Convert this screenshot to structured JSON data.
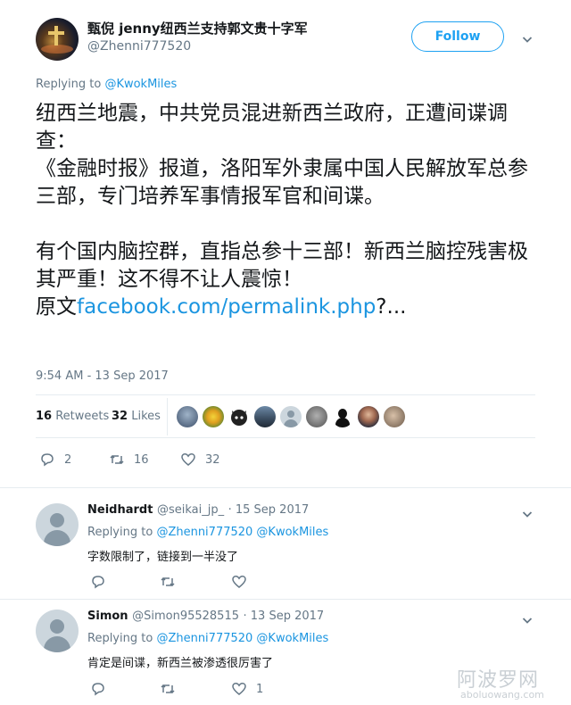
{
  "tweet": {
    "author_name": "甄倪 jenny纽西兰支持郭文贵十字军",
    "author_handle": "@Zhenni777520",
    "follow_label": "Follow",
    "replying_prefix": "Replying to",
    "replying_handle": "@KwokMiles",
    "text_main": "纽西兰地震，中共党员混进新西兰政府，正遭间谍调查：\n《金融时报》报道，洛阳军外隶属中国人民解放军总参三部，专门培养军事情报军官和间谍。\n\n有个国内脑控群，直指总参十三部！新西兰脑控残害极其严重！这不得不让人震惊！\n原文",
    "text_link": "facebook.com/permalink.php",
    "text_trail": "?...",
    "timestamp": "9:54 AM - 13 Sep 2017",
    "retweets_count": "16",
    "retweets_label": "Retweets",
    "likes_count": "32",
    "likes_label": "Likes",
    "reply_count": "2",
    "retweet_action_count": "16",
    "like_action_count": "32",
    "liker_avatars": [
      "avatar-1",
      "avatar-2",
      "avatar-3",
      "avatar-4",
      "avatar-5",
      "avatar-6",
      "avatar-7",
      "avatar-8",
      "avatar-9"
    ]
  },
  "replies": [
    {
      "name": "Neidhardt",
      "handle": "@seikai_jp_",
      "date": "· 15 Sep 2017",
      "replying_prefix": "Replying to",
      "replying_handles": "@Zhenni777520 @KwokMiles",
      "text": "字数限制了，链接到一半没了",
      "like_count": ""
    },
    {
      "name": "Simon",
      "handle": "@Simon95528515",
      "date": "· 13 Sep 2017",
      "replying_prefix": "Replying to",
      "replying_handles": "@Zhenni777520 @KwokMiles",
      "text": "肯定是间谍，新西兰被渗透很厉害了",
      "like_count": "1"
    }
  ],
  "watermark": {
    "cn": "阿波罗网",
    "en": "aboluowang.com"
  },
  "colors": {
    "accent": "#1da1f2",
    "link": "#1b95e0",
    "muted": "#657786",
    "divider": "#e6ecf0"
  }
}
